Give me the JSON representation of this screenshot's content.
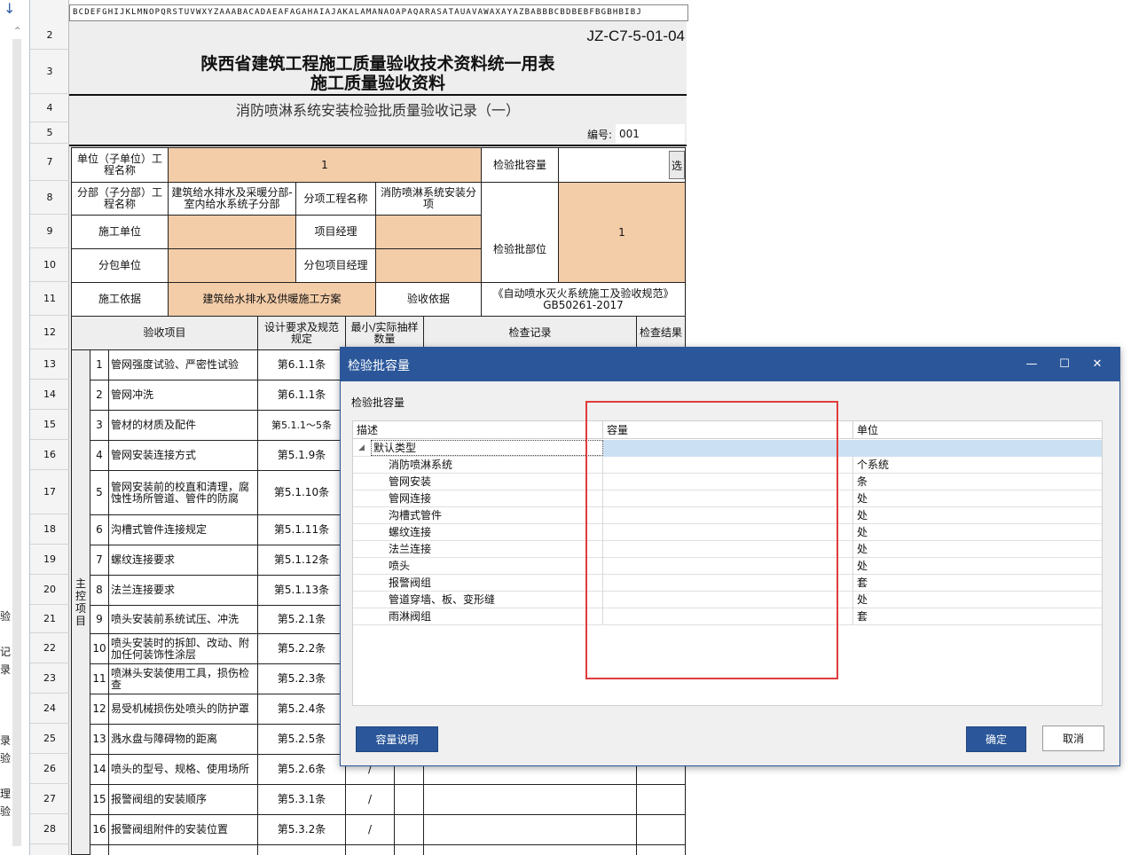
{
  "left_panel": {
    "arrow": "↓",
    "up": "^",
    "chars": [
      "验",
      "记",
      "录",
      "录",
      "验",
      "理",
      "验"
    ]
  },
  "columns_strip": "BCDEFGHIJKLMNOPQRSTUVWXYZAAABACADAEAFAGAHAIAJAKALAMANAOAPAQARASATAUAVAWAXAYAZBABBBCBDBEBFBGBHBIBJ",
  "row_numbers": [
    "2",
    "3",
    "4",
    "5",
    "7",
    "8",
    "9",
    "10",
    "11",
    "12",
    "13",
    "14",
    "15",
    "16",
    "17",
    "18",
    "19",
    "20",
    "21",
    "22",
    "23",
    "24",
    "25",
    "26",
    "27",
    "28"
  ],
  "form": {
    "code": "JZ-C7-5-01-04",
    "title1": "陕西省建筑工程施工质量验收技术资料统一用表",
    "title2": "施工质量验收资料",
    "subtitle": "消防喷淋系统安装检验批质量验收记录（一）",
    "number_label": "编号:",
    "number_value": "001",
    "unit_label": "单位（子单位）工程名称",
    "unit_value": "1",
    "capacity_label": "检验批容量",
    "select_btn": "选",
    "subdiv_label": "分部（子分部）工程名称",
    "subdiv_value": "建筑给水排水及采暖分部-室内给水系统子分部",
    "item_label": "分项工程名称",
    "item_value": "消防喷淋系统安装分项",
    "part_label": "检验批部位",
    "part_value": "1",
    "constructor_label": "施工单位",
    "pm_label": "项目经理",
    "subcontractor_label": "分包单位",
    "sub_pm_label": "分包项目经理",
    "basis_label": "施工依据",
    "basis_value": "建筑给水排水及供暖施工方案",
    "accept_basis_label": "验收依据",
    "accept_basis_value": "《自动喷水灭火系统施工及验收规范》GB50261-2017",
    "hdr_item": "验收项目",
    "hdr_design": "设计要求及规范规定",
    "hdr_sample": "最小/实际抽样数量",
    "hdr_record": "检查记录",
    "hdr_result": "检查结果",
    "main_control": "主控项目",
    "rows": [
      {
        "n": "1",
        "item": "管网强度试验、严密性试验",
        "clause": "第6.1.1条"
      },
      {
        "n": "2",
        "item": "管网冲洗",
        "clause": "第6.1.1条"
      },
      {
        "n": "3",
        "item": "管材的材质及配件",
        "clause": "第5.1.1～5条"
      },
      {
        "n": "4",
        "item": "管网安装连接方式",
        "clause": "第5.1.9条"
      },
      {
        "n": "5",
        "item": "管网安装前的校直和清理，腐蚀性场所管道、管件的防腐",
        "clause": "第5.1.10条"
      },
      {
        "n": "6",
        "item": "沟槽式管件连接规定",
        "clause": "第5.1.11条"
      },
      {
        "n": "7",
        "item": "螺纹连接要求",
        "clause": "第5.1.12条"
      },
      {
        "n": "8",
        "item": "法兰连接要求",
        "clause": "第5.1.13条"
      },
      {
        "n": "9",
        "item": "喷头安装前系统试压、冲洗",
        "clause": "第5.2.1条"
      },
      {
        "n": "10",
        "item": "喷头安装时的拆卸、改动、附加任何装饰性涂层",
        "clause": "第5.2.2条"
      },
      {
        "n": "11",
        "item": "喷淋头安装使用工具，损伤检查",
        "clause": "第5.2.3条"
      },
      {
        "n": "12",
        "item": "易受机械损伤处喷头的防护罩",
        "clause": "第5.2.4条"
      },
      {
        "n": "13",
        "item": "溅水盘与障碍物的距离",
        "clause": "第5.2.5条"
      },
      {
        "n": "14",
        "item": "喷头的型号、规格、使用场所",
        "clause": "第5.2.6条"
      },
      {
        "n": "15",
        "item": "报警阀组的安装顺序",
        "clause": "第5.3.1条"
      },
      {
        "n": "16",
        "item": "报警阀组附件的安装位置",
        "clause": "第5.3.2条"
      }
    ],
    "slash": "/"
  },
  "dialog": {
    "title": "检验批容量",
    "minimize": "—",
    "maximize": "☐",
    "close": "✕",
    "section_label": "检验批容量",
    "col_desc": "描述",
    "col_capacity": "容量",
    "col_unit": "单位",
    "group_label": "默认类型",
    "items": [
      {
        "desc": "消防喷淋系统",
        "unit": "个系统"
      },
      {
        "desc": "管网安装",
        "unit": "条"
      },
      {
        "desc": "管网连接",
        "unit": "处"
      },
      {
        "desc": "沟槽式管件",
        "unit": "处"
      },
      {
        "desc": "螺纹连接",
        "unit": "处"
      },
      {
        "desc": "法兰连接",
        "unit": "处"
      },
      {
        "desc": "喷头",
        "unit": "处"
      },
      {
        "desc": "报警阀组",
        "unit": "套"
      },
      {
        "desc": "管道穿墙、板、变形缝",
        "unit": "处"
      },
      {
        "desc": "雨淋阀组",
        "unit": "套"
      }
    ],
    "btn_explain": "容量说明",
    "btn_ok": "确定",
    "btn_cancel": "取消"
  },
  "colors": {
    "accent": "#2b579a",
    "peach": "#f3cca8",
    "highlight": "#e03c3c",
    "selected_row": "#cce0f4"
  }
}
